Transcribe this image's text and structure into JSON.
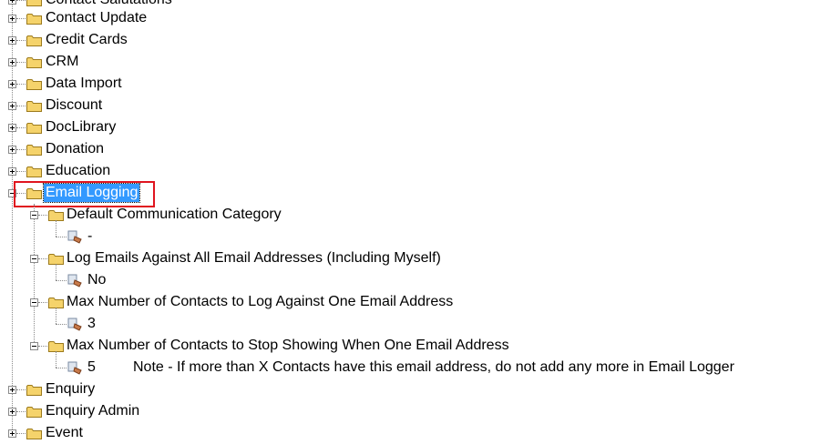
{
  "tree": {
    "top_items": [
      {
        "label": "Contact Salutations"
      },
      {
        "label": "Contact Update"
      },
      {
        "label": "Credit Cards"
      },
      {
        "label": "CRM"
      },
      {
        "label": "Data Import"
      },
      {
        "label": "Discount"
      },
      {
        "label": "DocLibrary"
      },
      {
        "label": "Donation"
      },
      {
        "label": "Education"
      }
    ],
    "expanded": {
      "label": "Email Logging",
      "children": [
        {
          "label": "Default Communication Category",
          "value": "-"
        },
        {
          "label": "Log Emails Against All Email Addresses (Including Myself)",
          "value": "No"
        },
        {
          "label": "Max Number of Contacts to Log Against One Email Address",
          "value": "3"
        },
        {
          "label": "Max Number of Contacts to Stop Showing When One Email Address",
          "value": "5",
          "note": "Note - If more than X Contacts have this email address, do not add any more in Email Logger"
        }
      ]
    },
    "bottom_items": [
      {
        "label": "Enquiry"
      },
      {
        "label": "Enquiry Admin"
      },
      {
        "label": "Event"
      }
    ]
  },
  "colors": {
    "selection": "#3399ff",
    "highlight_border": "#e0151f",
    "folder": "#f5d36b"
  },
  "icons": {
    "folder": "folder-icon",
    "leaf": "setting-value-icon"
  }
}
